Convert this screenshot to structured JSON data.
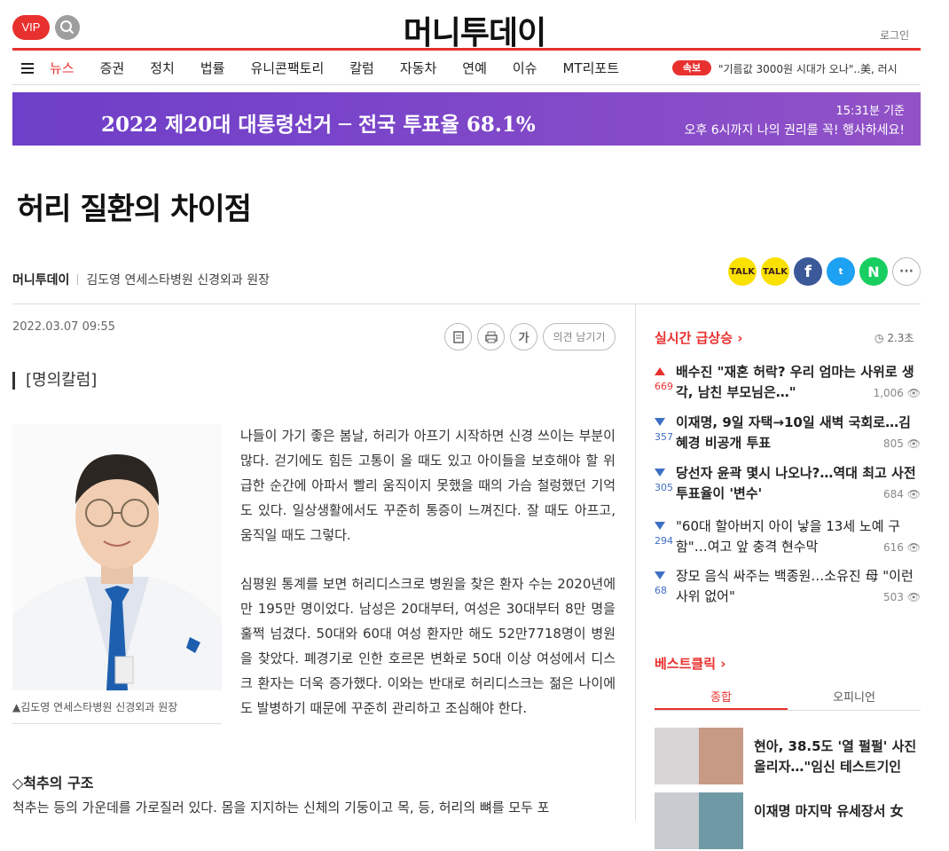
{
  "header": {
    "vip_label": "VIP",
    "logo_text": "머니투데이",
    "login_label": "로그인"
  },
  "nav": {
    "items": [
      "뉴스",
      "증권",
      "정치",
      "법률",
      "유니콘팩토리",
      "칼럼",
      "자동차",
      "연예",
      "이슈",
      "MT리포트"
    ],
    "active": "뉴스",
    "breaking_badge": "속보",
    "breaking_text": "\"기름값 3000원 시대가 오나\"..美, 러시"
  },
  "banner": {
    "title": "2022 제20대 대통령선거 ─ 전국 투표율 68.1%",
    "time": "15:31분 기준",
    "message": "오후 6시까지 나의 권리를 꼭! 행사하세요!",
    "color": "#7a45c9"
  },
  "article": {
    "title": "허리 질환의 차이점",
    "source": "머니투데이",
    "writer": "김도영 연세스타병원 신경외과 원장",
    "date": "2022.03.07  09:55",
    "font_tool_label": "가",
    "comment_label": "의견 남기기",
    "column_label": "[명의칼럼]",
    "photo_caption": "▲김도영 연세스타병원 신경외과 원장",
    "paragraph1": "나들이 가기 좋은 봄날, 허리가 아프기 시작하면 신경 쓰이는 부분이 많다. 걷기에도 힘든 고통이 올 때도 있고 아이들을 보호해야 할 위급한 순간에 아파서 빨리 움직이지 못했을 때의 가슴 철렁했던 기억도 있다. 일상생활에서도 꾸준히 통증이 느껴진다. 잘 때도 아프고, 움직일 때도 그렇다.",
    "paragraph2": "심평원 통계를 보면 허리디스크로 병원을 찾은 환자 수는 2020년에만 195만 명이었다. 남성은 20대부터, 여성은 30대부터 8만 명을 훌쩍 넘겼다. 50대와 60대 여성 환자만 해도 52만7718명이 병원을 찾았다. 폐경기로 인한 호르몬 변화로 50대 이상 여성에서 디스크 환자는 더욱 증가했다. 이와는 반대로 허리디스크는 젊은 나이에도 발병하기 때문에 꾸준히 관리하고 조심해야 한다.",
    "section_heading": "◇척추의 구조",
    "paragraph3": "척추는 등의 가운데를 가로질러 있다. 몸을 지지하는 신체의 기둥이고 목, 등, 허리의 뼈를 모두 포"
  },
  "share": {
    "kakao": "TALK",
    "kakaostory": "TALK",
    "facebook": "f",
    "twitter": "t",
    "naver": "N",
    "more": "···"
  },
  "realtime": {
    "title": "실시간 급상승 ›",
    "refresh": "2.3초",
    "items": [
      {
        "dir": "up",
        "num": "669",
        "text": "배수진 \"재혼 허락? 우리 엄마는 사위로 생각, 남친 부모님은…\"",
        "views": "1,006",
        "bold": true
      },
      {
        "dir": "down",
        "num": "357",
        "text": "이재명, 9일 자택→10일 새벽 국회로…김혜경 비공개 투표",
        "views": "805",
        "bold": true
      },
      {
        "dir": "down",
        "num": "305",
        "text": "당선자 윤곽 몇시 나오나?…역대 최고 사전투표율이 '변수'",
        "views": "684",
        "bold": true
      },
      {
        "dir": "down",
        "num": "294",
        "text": "\"60대 할아버지 아이 낳을 13세 노예 구함\"…여고 앞 충격 현수막",
        "views": "616",
        "bold": false
      },
      {
        "dir": "down",
        "num": "68",
        "text": "장모 음식 싸주는 백종원…소유진 母 \"이런 사위 없어\"",
        "views": "503",
        "bold": false
      }
    ]
  },
  "bestclick": {
    "title": "베스트클릭 ›",
    "tabs": [
      "종합",
      "오피니언"
    ],
    "active_tab": "종합",
    "items": [
      {
        "text": "현아, 38.5도 '열 펄펄' 사진 올리자…\"임신 테스트기인"
      },
      {
        "text": "이재명 마지막 유세장서 女"
      }
    ]
  },
  "colors": {
    "accent": "#e8312f",
    "down_arrow": "#3d6fc5"
  }
}
